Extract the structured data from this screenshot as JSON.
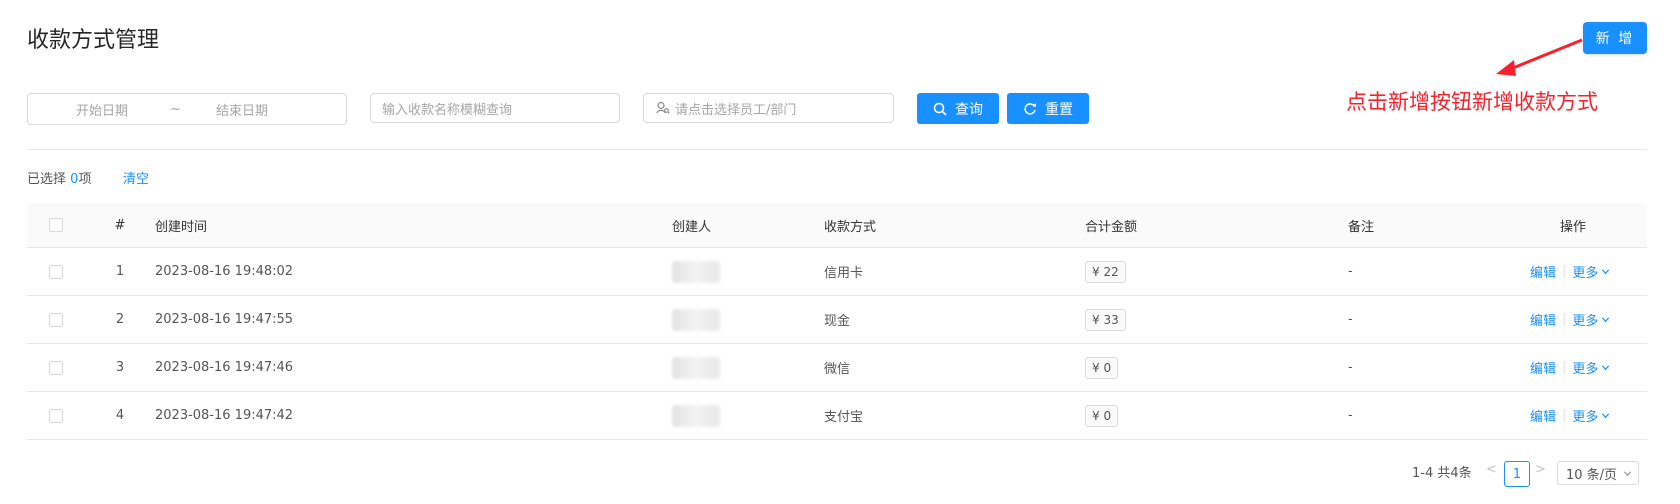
{
  "header": {
    "title": "收款方式管理",
    "add_button": "新 增",
    "annotation": "点击新增按钮新增收款方式"
  },
  "filters": {
    "start_date_placeholder": "开始日期",
    "tilde": "~",
    "end_date_placeholder": "结束日期",
    "search_placeholder": "输入收款名称模糊查询",
    "staff_placeholder": "请点击选择员工/部门",
    "query_button": "查询",
    "reset_button": "重置"
  },
  "selection": {
    "prefix": "已选择",
    "count": "0",
    "suffix": "项",
    "clear": "清空"
  },
  "table": {
    "columns": [
      "#",
      "创建时间",
      "创建人",
      "收款方式",
      "合计金额",
      "备注",
      "操作"
    ],
    "rows": [
      {
        "index": "1",
        "time": "2023-08-16 19:48:02",
        "method": "信用卡",
        "amount": "¥ 22",
        "note": "-",
        "edit": "编辑",
        "more": "更多"
      },
      {
        "index": "2",
        "time": "2023-08-16 19:47:55",
        "method": "现金",
        "amount": "¥ 33",
        "note": "-",
        "edit": "编辑",
        "more": "更多"
      },
      {
        "index": "3",
        "time": "2023-08-16 19:47:46",
        "method": "微信",
        "amount": "¥ 0",
        "note": "-",
        "edit": "编辑",
        "more": "更多"
      },
      {
        "index": "4",
        "time": "2023-08-16 19:47:42",
        "method": "支付宝",
        "amount": "¥ 0",
        "note": "-",
        "edit": "编辑",
        "more": "更多"
      }
    ]
  },
  "pagination": {
    "total": "1-4 共4条",
    "prev": "<",
    "current": "1",
    "next": ">",
    "page_size": "10 条/页"
  },
  "colors": {
    "primary": "#1890ff",
    "annotation": "#f5222d"
  }
}
